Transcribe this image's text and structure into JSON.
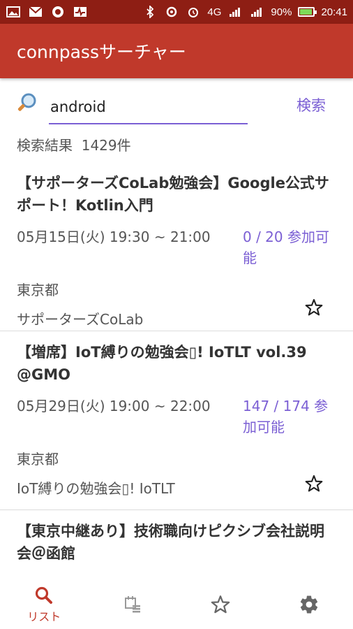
{
  "status_bar": {
    "battery": "90%",
    "time": "20:41",
    "signal_4g": "4G",
    "battery_level": 0.9
  },
  "app": {
    "title": "connpassサーチャー"
  },
  "search": {
    "query": "android",
    "button_label": "検索"
  },
  "results": {
    "label": "検索結果",
    "count": "1429件"
  },
  "events": [
    {
      "title": "【サポーターズCoLab勉強会】Google公式サポート！Kotlin入門",
      "datetime": "05月15日(火)  19:30 ~ 21:00",
      "capacity": "0 / 20 参加可能",
      "place": "東京都",
      "organizer": "サポーターズCoLab"
    },
    {
      "title": "【増席】IoT縛りの勉強会▯! IoTLT vol.39 @GMO",
      "datetime": "05月29日(火)  19:00 ~ 22:00",
      "capacity": "147 / 174 参加可能",
      "place": "東京都",
      "organizer": "IoT縛りの勉強会▯! IoTLT"
    },
    {
      "title": "【東京中継あり】技術職向けピクシブ会社説明会＠函館"
    }
  ],
  "nav": {
    "list_label": "リスト"
  },
  "colors": {
    "app_bar": "#c0392b",
    "status_bar": "#8e1e14",
    "accent": "#7b5fd4"
  }
}
